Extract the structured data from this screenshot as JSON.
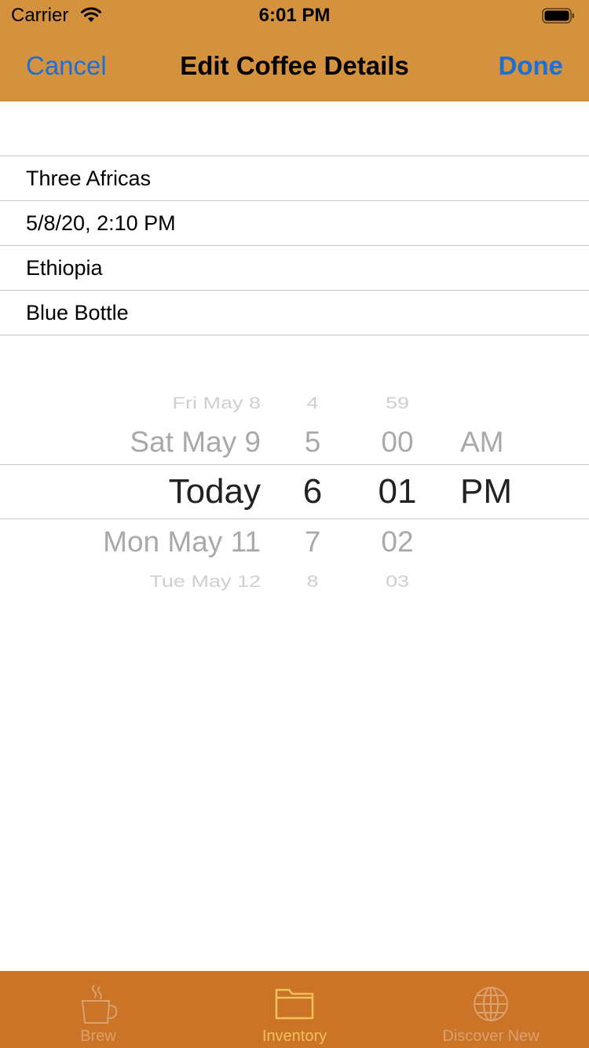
{
  "status_bar": {
    "carrier": "Carrier",
    "time": "6:01 PM"
  },
  "nav": {
    "cancel_label": "Cancel",
    "title": "Edit Coffee Details",
    "done_label": "Done",
    "accent_color": "#1c6fd6",
    "bar_color": "#d4913e"
  },
  "form": {
    "fields": [
      {
        "value": "Three Africas"
      },
      {
        "value": "5/8/20, 2:10 PM"
      },
      {
        "value": "Ethiopia"
      },
      {
        "value": "Blue Bottle"
      }
    ]
  },
  "picker": {
    "dates": [
      "Fri May 8",
      "Sat May 9",
      "Today",
      "Mon May 11",
      "Tue May 12"
    ],
    "hours": [
      "4",
      "5",
      "6",
      "7",
      "8"
    ],
    "minutes": [
      "59",
      "00",
      "01",
      "02",
      "03"
    ],
    "ampm": [
      "AM",
      "PM"
    ],
    "selected": {
      "date": "Today",
      "hour": "6",
      "minute": "01",
      "ampm": "PM"
    }
  },
  "tab_bar": {
    "tabs": [
      {
        "label": "Brew",
        "icon": "coffee-cup-icon",
        "active": false
      },
      {
        "label": "Inventory",
        "icon": "folder-icon",
        "active": true
      },
      {
        "label": "Discover New",
        "icon": "globe-icon",
        "active": false
      }
    ],
    "bar_color": "#cb7326",
    "active_color": "#f2c15a"
  }
}
